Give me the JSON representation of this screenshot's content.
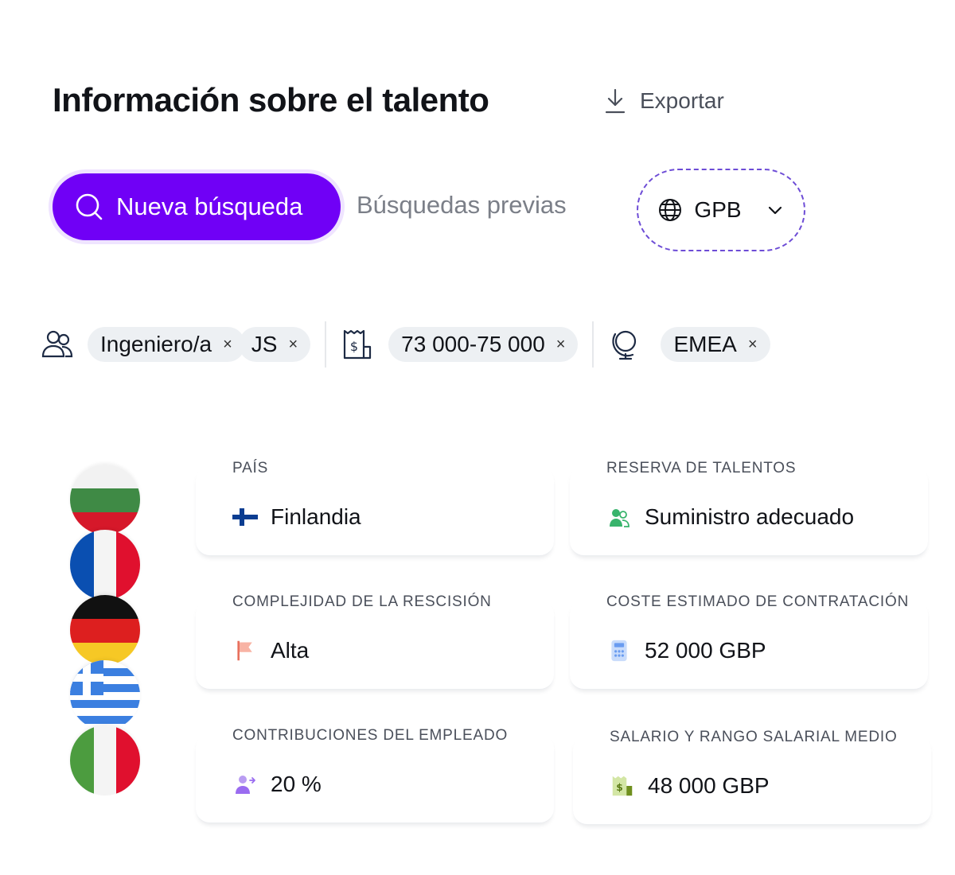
{
  "header": {
    "title": "Información sobre el talento",
    "export_label": "Exportar"
  },
  "tabs": {
    "new_search": "Nueva búsqueda",
    "previous_searches": "Búsquedas previas"
  },
  "currency": {
    "selected": "GPB",
    "icon": "globe-icon"
  },
  "filters": {
    "role_chips": [
      "Ingeniero/a",
      "JS"
    ],
    "salary_chip": "73 000-75 000",
    "region_chip": "EMEA",
    "remove_glyph": "×"
  },
  "flags": [
    "bulgaria",
    "france",
    "germany",
    "greece",
    "italy"
  ],
  "cards": {
    "country": {
      "label": "PAÍS",
      "value": "Finlandia"
    },
    "talent_pool": {
      "label": "RESERVA DE TALENTOS",
      "value": "Suministro adecuado"
    },
    "termination": {
      "label": "COMPLEJIDAD DE LA RESCISIÓN",
      "value": "Alta"
    },
    "hiring_cost": {
      "label": "COSTE ESTIMADO DE CONTRATACIÓN",
      "value": "52 000 GBP"
    },
    "contributions": {
      "label": "CONTRIBUCIONES DEL EMPLEADO",
      "value": "20 %"
    },
    "salary": {
      "label": "SALARIO Y RANGO SALARIAL MEDIO",
      "value": "48 000 GBP"
    }
  },
  "colors": {
    "primary": "#7000f6",
    "dashed_border": "#6d4cd6",
    "chip_bg": "#edf0f3"
  }
}
